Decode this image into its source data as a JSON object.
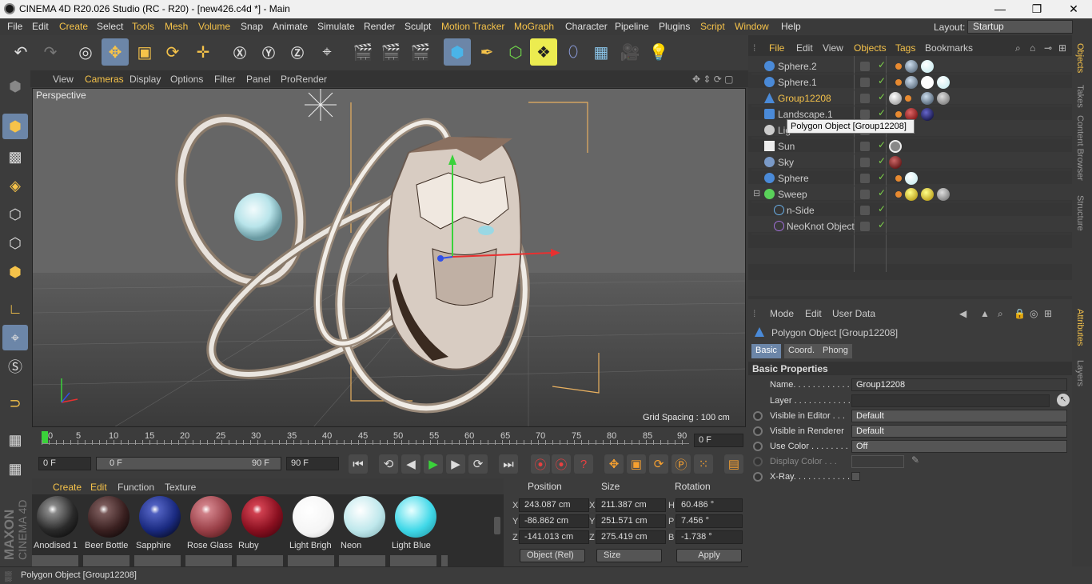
{
  "window": {
    "title": "CINEMA 4D R20.026 Studio (RC - R20) - [new426.c4d *] - Main",
    "minimize": "—",
    "maximize": "❐",
    "close": "✕"
  },
  "menu": [
    "File",
    "Edit",
    "Create",
    "Select",
    "Tools",
    "Mesh",
    "Volume",
    "Snap",
    "Animate",
    "Simulate",
    "Render",
    "Sculpt",
    "Motion Tracker",
    "MoGraph",
    "Character",
    "Pipeline",
    "Plugins",
    "Script",
    "Window",
    "Help"
  ],
  "layout": {
    "label": "Layout:",
    "value": "Startup"
  },
  "viewport": {
    "menu": [
      "View",
      "Cameras",
      "Display",
      "Options",
      "Filter",
      "Panel",
      "ProRender"
    ],
    "label": "Perspective",
    "grid_spacing": "Grid Spacing : 100 cm"
  },
  "timeline": {
    "ticks": [
      "0",
      "5",
      "10",
      "15",
      "20",
      "25",
      "30",
      "35",
      "40",
      "45",
      "50",
      "55",
      "60",
      "65",
      "70",
      "75",
      "80",
      "85",
      "90"
    ],
    "current_frame": "0 F",
    "start": "0 F",
    "range_start": "0 F",
    "range_end": "90 F",
    "end": "90 F"
  },
  "materials": {
    "menu": [
      "Create",
      "Edit",
      "Function",
      "Texture"
    ],
    "items": [
      {
        "name": "Anodised 1",
        "color": "#2a2a2a"
      },
      {
        "name": "Beer Bottle",
        "color": "#3a2020"
      },
      {
        "name": "Sapphire",
        "color": "#1a2a80"
      },
      {
        "name": "Rose Glass",
        "color": "#9a4048"
      },
      {
        "name": "Ruby",
        "color": "#8a1020"
      },
      {
        "name": "Light Brigh",
        "color": "#f5f5f5"
      },
      {
        "name": "Neon",
        "color": "#bfe8ec"
      },
      {
        "name": "Light Blue",
        "color": "#40d8e8"
      }
    ]
  },
  "coords": {
    "headers": [
      "Position",
      "Size",
      "Rotation"
    ],
    "rows": [
      {
        "axis": "X",
        "pos": "243.087 cm",
        "size_axis": "X",
        "size": "211.387 cm",
        "rot_axis": "H",
        "rot": "60.486 °"
      },
      {
        "axis": "Y",
        "pos": "-86.862 cm",
        "size_axis": "Y",
        "size": "251.571 cm",
        "rot_axis": "P",
        "rot": "7.456 °"
      },
      {
        "axis": "Z",
        "pos": "-141.013 cm",
        "size_axis": "Z",
        "size": "275.419 cm",
        "rot_axis": "B",
        "rot": "-1.738 °"
      }
    ],
    "mode": "Object (Rel)",
    "size_mode": "Size",
    "apply": "Apply"
  },
  "objects": {
    "menu": [
      "File",
      "Edit",
      "View",
      "Objects",
      "Tags",
      "Bookmarks"
    ],
    "items": [
      {
        "name": "Sphere.2",
        "icon": "sphere-icon"
      },
      {
        "name": "Sphere.1",
        "icon": "sphere-icon"
      },
      {
        "name": "Group12208",
        "icon": "polygon-icon"
      },
      {
        "name": "Landscape.1",
        "icon": "landscape-icon"
      },
      {
        "name": "Light",
        "icon": "light-icon"
      },
      {
        "name": "Sun",
        "icon": "sun-icon"
      },
      {
        "name": "Sky",
        "icon": "sky-icon"
      },
      {
        "name": "Sphere",
        "icon": "sphere-icon"
      },
      {
        "name": "Sweep",
        "icon": "sweep-icon"
      },
      {
        "name": "n-Side",
        "icon": "nside-icon"
      },
      {
        "name": "NeoKnot Object",
        "icon": "knot-icon"
      }
    ],
    "tooltip": "Polygon Object [Group12208]"
  },
  "attributes": {
    "menu": [
      "Mode",
      "Edit",
      "User Data"
    ],
    "object_title": "Polygon Object [Group12208]",
    "tabs": [
      "Basic",
      "Coord.",
      "Phong"
    ],
    "section": "Basic Properties",
    "fields": [
      {
        "label": "Name. . . . . . . . . . . .",
        "value": "Group12208"
      },
      {
        "label": "Layer . . . . . . . . . . . .",
        "value": ""
      },
      {
        "label": "Visible in Editor . . .",
        "value": "Default"
      },
      {
        "label": "Visible in Renderer",
        "value": "Default"
      },
      {
        "label": "Use Color . . . . . . . .",
        "value": "Off"
      },
      {
        "label": "Display Color . . .",
        "value": ""
      },
      {
        "label": "X-Ray. . . . . . . . . . . .",
        "value": ""
      }
    ]
  },
  "right_tabs": [
    "Objects",
    "Takes",
    "Content Browser",
    "Structure",
    "Attributes",
    "Layers"
  ],
  "status": "Polygon Object [Group12208]",
  "branding": {
    "maxon": "MAXON",
    "c4d": "CINEMA 4D"
  }
}
